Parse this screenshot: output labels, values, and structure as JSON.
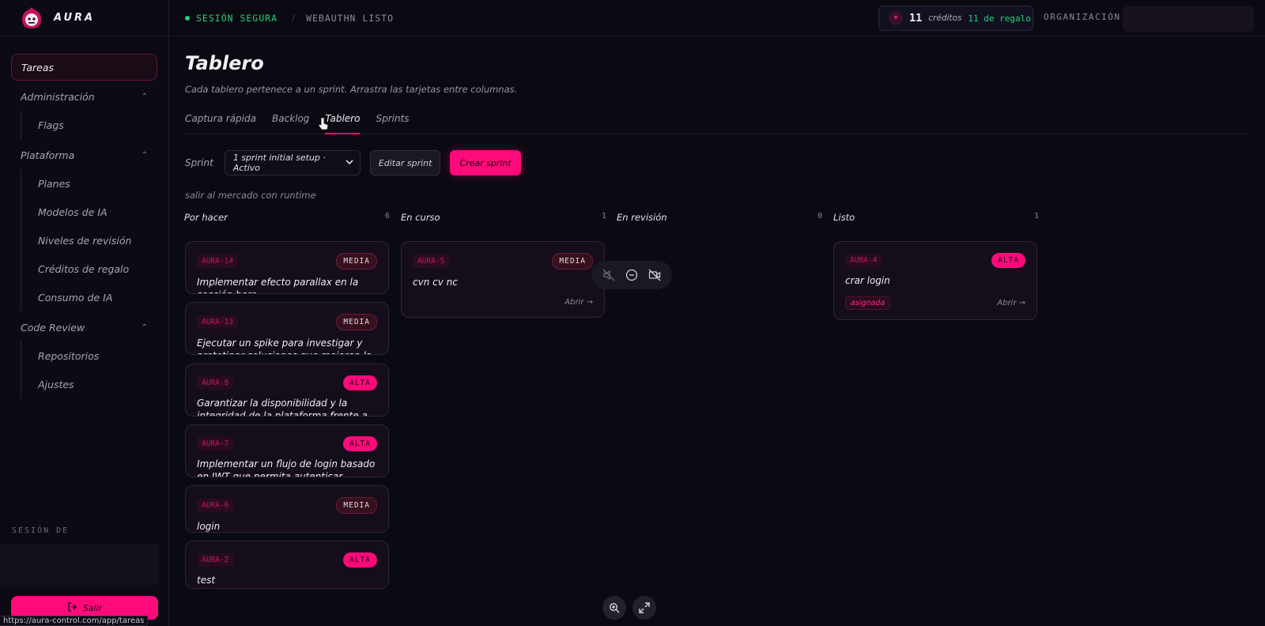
{
  "app": {
    "brand": "AURA",
    "url": "https://aura-control.com/app/tareas"
  },
  "topbar": {
    "secure": "SESIÓN SEGURA",
    "separator": "/",
    "webauthn": "WEBAUTHN LISTO",
    "credits_num": "11",
    "credits_word": "créditos",
    "credits_gift": "11 de regalo",
    "org_label": "ORGANIZACIÓN:"
  },
  "sidebar": {
    "active": "Tareas",
    "groups": [
      {
        "label": "Administración",
        "items": [
          "Flags"
        ]
      },
      {
        "label": "Plataforma",
        "items": [
          "Planes",
          "Modelos de IA",
          "Niveles de revisión",
          "Créditos de regalo",
          "Consumo de IA"
        ]
      },
      {
        "label": "Code Review",
        "items": [
          "Repositorios",
          "Ajustes"
        ]
      }
    ],
    "session_label": "SESIÓN DE",
    "logout": "Salir"
  },
  "main": {
    "title": "Tablero",
    "subtitle": "Cada tablero pertenece a un sprint. Arrastra las tarjetas entre columnas.",
    "tabs": [
      "Captura rápida",
      "Backlog",
      "Tablero",
      "Sprints"
    ],
    "sprint_label": "Sprint",
    "sprint_selected": "1 sprint initial setup · Activo",
    "edit_sprint": "Editar sprint",
    "create_sprint": "Crear sprint",
    "sprint_goal": "salir al mercado con runtime",
    "open_label": "Abrir →",
    "assigned_label": "asignada"
  },
  "board": {
    "columns": [
      {
        "title": "Por hacer",
        "count": "6"
      },
      {
        "title": "En curso",
        "count": "1"
      },
      {
        "title": "En revisión",
        "count": "0"
      },
      {
        "title": "Listo",
        "count": "1"
      }
    ],
    "cards": [
      {
        "id": "AURA-14",
        "priority": "MEDIA",
        "title": "Implementar efecto parallax en la sección hero"
      },
      {
        "id": "AURA-13",
        "priority": "MEDIA",
        "title": "Ejecutar un spike para investigar y prototipar soluciones que mejoren la"
      },
      {
        "id": "AURA-8",
        "priority": "ALTA",
        "title": "Garantizar la disponibilidad y la integridad de la plataforma frente a"
      },
      {
        "id": "AURA-7",
        "priority": "ALTA",
        "title": "Implementar un flujo de login basado en JWT que permita autenticar usuarios"
      },
      {
        "id": "AURA-6",
        "priority": "MEDIA",
        "title": "login"
      },
      {
        "id": "AURA-2",
        "priority": "ALTA",
        "title": "test"
      },
      {
        "id": "AURA-5",
        "priority": "MEDIA",
        "title": "cvn cv nc"
      },
      {
        "id": "AURA-4",
        "priority": "ALTA",
        "title": "crar login"
      }
    ]
  },
  "colors": {
    "accent": "#ff0a7a",
    "success": "#27d07a",
    "background": "#0b0a12"
  },
  "icons": [
    "logo-icon",
    "chevron-up-icon",
    "logout-icon",
    "star-icon",
    "mute-icon",
    "minus-circle-icon",
    "video-off-icon",
    "zoom-in-icon",
    "expand-icon",
    "pointer-cursor-icon",
    "select-chevron-icon"
  ]
}
